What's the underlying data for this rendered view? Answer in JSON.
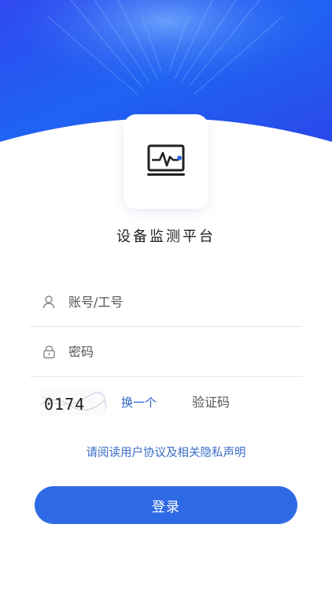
{
  "app": {
    "title": "设备监测平台"
  },
  "login": {
    "account_placeholder": "账号/工号",
    "password_placeholder": "密码",
    "captcha_text": "0174",
    "captcha_refresh_label": "换一个",
    "captcha_placeholder": "验证码",
    "agreement_label": "请阅读用户协议及相关隐私声明",
    "submit_label": "登录"
  },
  "colors": {
    "accent": "#2f6ae6",
    "header_blue": "#1f5ef0",
    "link": "#3a6cc6"
  },
  "icons": {
    "logo": "monitor-pulse-icon",
    "account": "user-icon",
    "password": "lock-icon"
  }
}
